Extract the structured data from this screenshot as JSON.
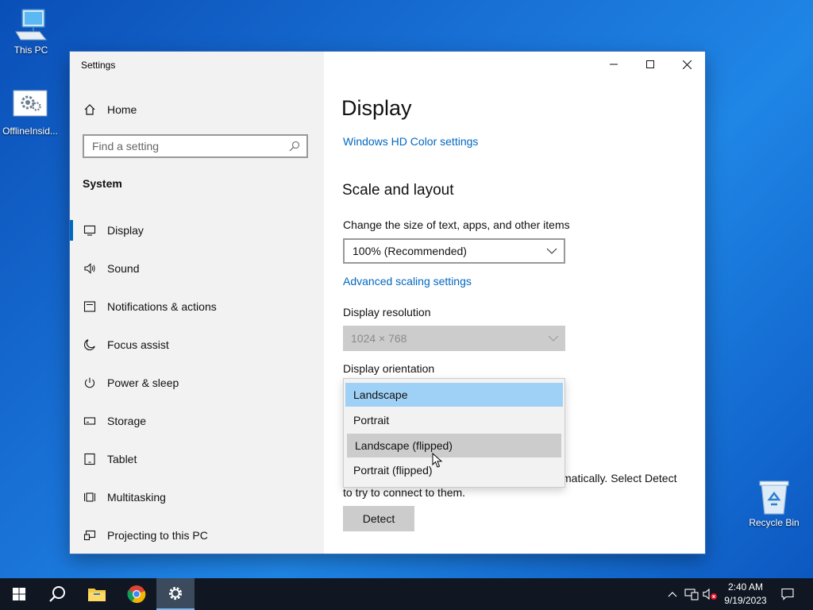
{
  "desktop": {
    "icons": [
      {
        "label": "This PC"
      },
      {
        "label": "OfflineInsid..."
      },
      {
        "label": "Recycle Bin"
      }
    ]
  },
  "window": {
    "title": "Settings",
    "controls": {
      "minimize": "minimize-icon",
      "maximize": "maximize-icon",
      "close": "close-icon"
    }
  },
  "sidebar": {
    "home_label": "Home",
    "search_placeholder": "Find a setting",
    "section_title": "System",
    "items": [
      {
        "label": "Display",
        "icon": "monitor-icon",
        "active": true
      },
      {
        "label": "Sound",
        "icon": "speaker-icon"
      },
      {
        "label": "Notifications & actions",
        "icon": "notification-icon"
      },
      {
        "label": "Focus assist",
        "icon": "moon-icon"
      },
      {
        "label": "Power & sleep",
        "icon": "power-icon"
      },
      {
        "label": "Storage",
        "icon": "storage-icon"
      },
      {
        "label": "Tablet",
        "icon": "tablet-icon"
      },
      {
        "label": "Multitasking",
        "icon": "multitasking-icon"
      },
      {
        "label": "Projecting to this PC",
        "icon": "projector-icon"
      }
    ]
  },
  "content": {
    "page_title": "Display",
    "hd_color_link": "Windows HD Color settings",
    "scale_heading": "Scale and layout",
    "scale_label": "Change the size of text, apps, and other items",
    "scale_value": "100% (Recommended)",
    "advanced_scaling_link": "Advanced scaling settings",
    "resolution_label": "Display resolution",
    "resolution_value": "1024 × 768",
    "orientation_label": "Display orientation",
    "orientation_options": [
      {
        "label": "Landscape",
        "state": "selected"
      },
      {
        "label": "Portrait",
        "state": "normal"
      },
      {
        "label": "Landscape (flipped)",
        "state": "hover"
      },
      {
        "label": "Portrait (flipped)",
        "state": "normal"
      }
    ],
    "detect_text_line1": "matically. Select Detect",
    "detect_text_line2": "to try to connect to them.",
    "detect_button": "Detect"
  },
  "taskbar": {
    "clock_time": "2:40 AM",
    "clock_date": "9/19/2023"
  },
  "colors": {
    "accent": "#0067c0",
    "selected_option": "#9fd1f7",
    "hover_option": "#cccccc",
    "taskbar": "#101722",
    "gear_active_bg": "#3b4a5c"
  }
}
